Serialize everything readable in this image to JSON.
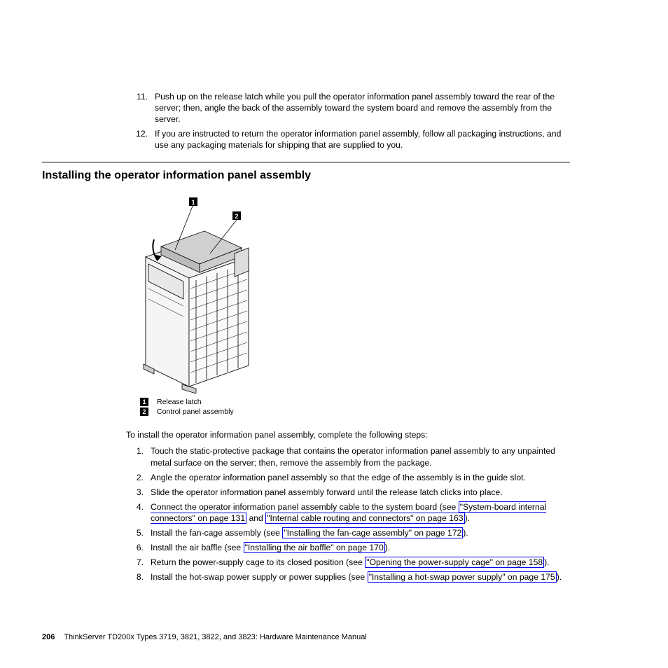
{
  "top_items": [
    {
      "n": "11.",
      "t": "Push up on the release latch while you pull the operator information panel assembly toward the rear of the server; then, angle the back of the assembly toward the system board and remove the assembly from the server."
    },
    {
      "n": "12.",
      "t": "If you are instructed to return the operator information panel assembly, follow all packaging instructions, and use any packaging materials for shipping that are supplied to you."
    }
  ],
  "section_title": "Installing the operator information panel assembly",
  "callouts": {
    "c1": "1",
    "c2": "2"
  },
  "legend": [
    {
      "num": "1",
      "label": "Release latch"
    },
    {
      "num": "2",
      "label": "Control panel assembly"
    }
  ],
  "intro": "To install the operator information panel assembly, complete the following steps:",
  "steps": [
    {
      "n": "1.",
      "parts": [
        {
          "t": "Touch the static-protective package that contains the operator information panel assembly to any unpainted metal surface on the server; then, remove the assembly from the package."
        }
      ]
    },
    {
      "n": "2.",
      "parts": [
        {
          "t": "Angle the operator information panel assembly so that the edge of the assembly is in the guide slot."
        }
      ]
    },
    {
      "n": "3.",
      "parts": [
        {
          "t": "Slide the operator information panel assembly forward until the release latch clicks into place."
        }
      ]
    },
    {
      "n": "4.",
      "parts": [
        {
          "t": "Connect the operator information panel assembly cable to the system board (see "
        },
        {
          "link": true,
          "t": "\"System-board internal connectors\" on page 131"
        },
        {
          "t": " and "
        },
        {
          "link": true,
          "t": "\"Internal cable routing and connectors\" on page 163"
        },
        {
          "t": ")."
        }
      ]
    },
    {
      "n": "5.",
      "parts": [
        {
          "t": "Install the fan-cage assembly (see "
        },
        {
          "link": true,
          "t": "\"Installing the fan-cage assembly\" on page 172"
        },
        {
          "t": ")."
        }
      ]
    },
    {
      "n": "6.",
      "parts": [
        {
          "t": "Install the air baffle (see "
        },
        {
          "link": true,
          "t": "\"Installing the air baffle\" on page 170"
        },
        {
          "t": ")."
        }
      ]
    },
    {
      "n": "7.",
      "parts": [
        {
          "t": "Return the power-supply cage to its closed position (see "
        },
        {
          "link": true,
          "t": "\"Opening the power-supply cage\" on page 158"
        },
        {
          "t": ")."
        }
      ]
    },
    {
      "n": "8.",
      "parts": [
        {
          "t": "Install the hot-swap power supply or power supplies (see "
        },
        {
          "link": true,
          "t": "\"Installing a hot-swap power supply\" on page 175"
        },
        {
          "t": ")."
        }
      ]
    }
  ],
  "footer": {
    "page": "206",
    "text": "ThinkServer TD200x Types 3719, 3821, 3822, and 3823: Hardware Maintenance Manual"
  }
}
